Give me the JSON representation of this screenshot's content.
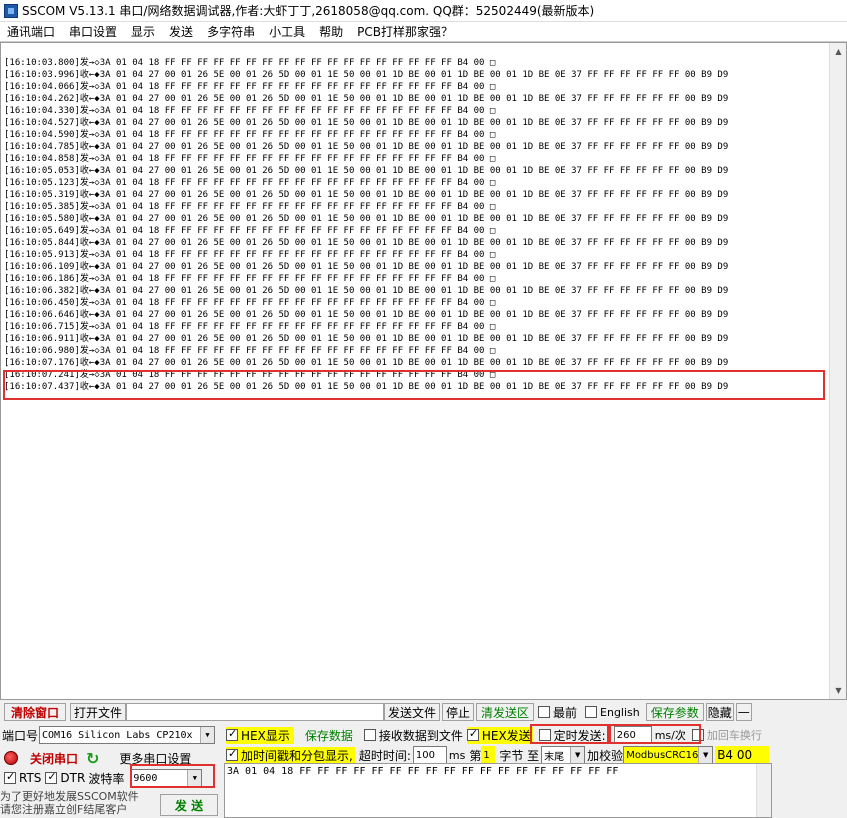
{
  "window": {
    "title": "SSCOM V5.13.1 串口/网络数据调试器,作者:大虾丁丁,2618058@qq.com. QQ群：52502449(最新版本)"
  },
  "menu": [
    "通讯端口",
    "串口设置",
    "显示",
    "发送",
    "多字符串",
    "小工具",
    "帮助",
    "PCB打样那家强？"
  ],
  "log": {
    "lines": [
      "[16:10:03.800]发→◇3A 01 04 18 FF FF FF FF FF FF FF FF FF FF FF FF FF FF FF FF FF FF B4 00 □",
      "[16:10:03.996]收←◆3A 01 04 27 00 01 26 5E 00 01 26 5D 00 01 1E 50 00 01 1D BE 00 01 1D BE 00 01 1D BE 0E 37 FF FF FF FF FF FF 00 B9 D9",
      "[16:10:04.066]发→◇3A 01 04 18 FF FF FF FF FF FF FF FF FF FF FF FF FF FF FF FF FF FF B4 00 □",
      "[16:10:04.262]收←◆3A 01 04 27 00 01 26 5E 00 01 26 5D 00 01 1E 50 00 01 1D BE 00 01 1D BE 00 01 1D BE 0E 37 FF FF FF FF FF FF 00 B9 D9",
      "[16:10:04.330]发→◇3A 01 04 18 FF FF FF FF FF FF FF FF FF FF FF FF FF FF FF FF FF FF B4 00 □",
      "[16:10:04.527]收←◆3A 01 04 27 00 01 26 5E 00 01 26 5D 00 01 1E 50 00 01 1D BE 00 01 1D BE 00 01 1D BE 0E 37 FF FF FF FF FF FF 00 B9 D9",
      "[16:10:04.590]发→◇3A 01 04 18 FF FF FF FF FF FF FF FF FF FF FF FF FF FF FF FF FF FF B4 00 □",
      "[16:10:04.785]收←◆3A 01 04 27 00 01 26 5E 00 01 26 5D 00 01 1E 50 00 01 1D BE 00 01 1D BE 00 01 1D BE 0E 37 FF FF FF FF FF FF 00 B9 D9",
      "[16:10:04.858]发→◇3A 01 04 18 FF FF FF FF FF FF FF FF FF FF FF FF FF FF FF FF FF FF B4 00 □",
      "[16:10:05.053]收←◆3A 01 04 27 00 01 26 5E 00 01 26 5D 00 01 1E 50 00 01 1D BE 00 01 1D BE 00 01 1D BE 0E 37 FF FF FF FF FF FF 00 B9 D9",
      "[16:10:05.123]发→◇3A 01 04 18 FF FF FF FF FF FF FF FF FF FF FF FF FF FF FF FF FF FF B4 00 □",
      "[16:10:05.319]收←◆3A 01 04 27 00 01 26 5E 00 01 26 5D 00 01 1E 50 00 01 1D BE 00 01 1D BE 00 01 1D BE 0E 37 FF FF FF FF FF FF 00 B9 D9",
      "[16:10:05.385]发→◇3A 01 04 18 FF FF FF FF FF FF FF FF FF FF FF FF FF FF FF FF FF FF B4 00 □",
      "[16:10:05.580]收←◆3A 01 04 27 00 01 26 5E 00 01 26 5D 00 01 1E 50 00 01 1D BE 00 01 1D BE 00 01 1D BE 0E 37 FF FF FF FF FF FF 00 B9 D9",
      "[16:10:05.649]发→◇3A 01 04 18 FF FF FF FF FF FF FF FF FF FF FF FF FF FF FF FF FF FF B4 00 □",
      "[16:10:05.844]收←◆3A 01 04 27 00 01 26 5E 00 01 26 5D 00 01 1E 50 00 01 1D BE 00 01 1D BE 00 01 1D BE 0E 37 FF FF FF FF FF FF 00 B9 D9",
      "[16:10:05.913]发→◇3A 01 04 18 FF FF FF FF FF FF FF FF FF FF FF FF FF FF FF FF FF FF B4 00 □",
      "[16:10:06.109]收←◆3A 01 04 27 00 01 26 5E 00 01 26 5D 00 01 1E 50 00 01 1D BE 00 01 1D BE 00 01 1D BE 0E 37 FF FF FF FF FF FF 00 B9 D9",
      "[16:10:06.186]发→◇3A 01 04 18 FF FF FF FF FF FF FF FF FF FF FF FF FF FF FF FF FF FF B4 00 □",
      "[16:10:06.382]收←◆3A 01 04 27 00 01 26 5E 00 01 26 5D 00 01 1E 50 00 01 1D BE 00 01 1D BE 00 01 1D BE 0E 37 FF FF FF FF FF FF 00 B9 D9",
      "[16:10:06.450]发→◇3A 01 04 18 FF FF FF FF FF FF FF FF FF FF FF FF FF FF FF FF FF FF B4 00 □",
      "[16:10:06.646]收←◆3A 01 04 27 00 01 26 5E 00 01 26 5D 00 01 1E 50 00 01 1D BE 00 01 1D BE 00 01 1D BE 0E 37 FF FF FF FF FF FF 00 B9 D9",
      "[16:10:06.715]发→◇3A 01 04 18 FF FF FF FF FF FF FF FF FF FF FF FF FF FF FF FF FF FF B4 00 □",
      "[16:10:06.911]收←◆3A 01 04 27 00 01 26 5E 00 01 26 5D 00 01 1E 50 00 01 1D BE 00 01 1D BE 00 01 1D BE 0E 37 FF FF FF FF FF FF 00 B9 D9",
      "[16:10:06.980]发→◇3A 01 04 18 FF FF FF FF FF FF FF FF FF FF FF FF FF FF FF FF FF FF B4 00 □",
      "[16:10:07.176]收←◆3A 01 04 27 00 01 26 5E 00 01 26 5D 00 01 1E 50 00 01 1D BE 00 01 1D BE 00 01 1D BE 0E 37 FF FF FF FF FF FF 00 B9 D9",
      "[16:10:07.241]发→◇3A 01 04 18 FF FF FF FF FF FF FF FF FF FF FF FF FF FF FF FF FF FF B4 00 □",
      "[16:10:07.437]收←◆3A 01 04 27 00 01 26 5E 00 01 26 5D 00 01 1E 50 00 01 1D BE 00 01 1D BE 00 01 1D BE 0E 37 FF FF FF FF FF FF 00 B9 D9"
    ]
  },
  "toolbar": {
    "clear_window": "清除窗口",
    "open_file": "打开文件",
    "send_file": "发送文件",
    "stop": "停止",
    "clear_send": "清发送区",
    "topmost": "最前",
    "english": "English",
    "save_params": "保存参数",
    "hide": "隐藏",
    "more": "—"
  },
  "port": {
    "port_label": "端口号",
    "port_value": "COM16 Silicon Labs CP210x",
    "close_port": "关闭串口",
    "more_settings": "更多串口设置",
    "rts": "RTS",
    "dtr": "DTR",
    "baud_label": "波特率",
    "baud_value": "9600",
    "promo1": "为了更好地发展SSCOM软件",
    "promo2": "请您注册嘉立创F结尾客户"
  },
  "options": {
    "hex_display": "HEX显示",
    "save_data": "保存数据",
    "recv_to_file": "接收数据到文件",
    "hex_send": "HEX发送",
    "timed_send": "定时发送:",
    "interval_value": "260",
    "interval_unit": "ms/次",
    "add_crlf": "加回车换行",
    "timestamp": "加时间戳和分包显示,",
    "timeout_label": "超时时间:",
    "timeout_value": "100",
    "timeout_unit": "ms",
    "nth_label": "第",
    "nth_value": "1",
    "byte_label": "字节 至",
    "end_value": "末尾",
    "checksum_label": "加校验",
    "checksum_value": "ModbusCRC16",
    "checksum_result": "B4 00",
    "send_button": "发 送"
  },
  "send_area": {
    "content": "3A 01 04 18 FF FF FF FF FF FF FF FF FF FF FF FF FF FF FF FF FF FF"
  }
}
